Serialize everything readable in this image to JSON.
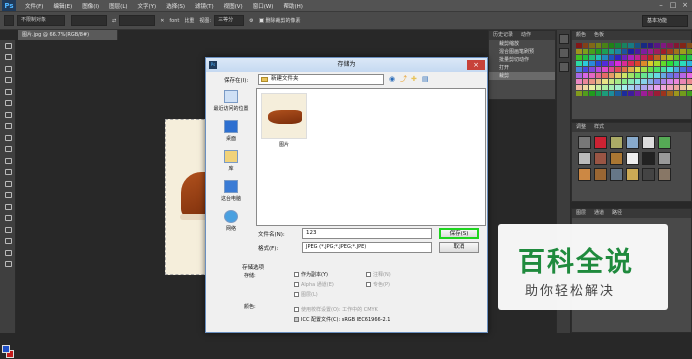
{
  "menubar": {
    "app_logo": "Ps",
    "items": [
      "文件(F)",
      "编辑(E)",
      "图像(I)",
      "图层(L)",
      "文字(Y)",
      "选择(S)",
      "滤镜(T)",
      "视图(V)",
      "窗口(W)",
      "帮助(H)"
    ]
  },
  "optbar": {
    "style_value": "不限制对象",
    "font_label": "font",
    "antialias_label": "比重",
    "view_label": "视图:",
    "view_value": "三等分",
    "delete_cropped": "删除裁剪的像素",
    "workspace": "基本功能"
  },
  "doc_tab": "图片.jpg @ 66.7%(RGB/8#)",
  "history_panel": {
    "tabs": [
      "历史记录",
      "动作"
    ],
    "items": [
      "裁剪缩放",
      "混合图画笔刷预",
      "批量剪切动作",
      "打开",
      "裁剪"
    ]
  },
  "swatches_panel": {
    "tabs": [
      "颜色",
      "色板"
    ]
  },
  "styles_panel": {
    "tabs": [
      "调整",
      "样式"
    ]
  },
  "layers_panel": {
    "tabs": [
      "图层",
      "通道",
      "路径"
    ]
  },
  "dialog": {
    "title": "存储为",
    "app_icon": "Ps",
    "close": "×",
    "save_in_label": "保存在(I):",
    "save_in_value": "新建文件夹",
    "places": [
      "最近访问的位置",
      "桌面",
      "库",
      "这台电脑",
      "网络"
    ],
    "file_item": "图片",
    "filename_label": "文件名(N):",
    "filename_value": "123",
    "format_label": "格式(F):",
    "format_value": "JPEG (*.JPG;*.JPEG;*.JPE)",
    "save_button": "保存(S)",
    "cancel_button": "取消",
    "save_options_title": "存储选项",
    "save_label": "存储:",
    "as_copy": "作为副本(Y)",
    "notes": "注释(N)",
    "alpha": "Alpha 通道(E)",
    "spot": "专色(P)",
    "layers": "图层(L)",
    "color_label": "颜色:",
    "proof_setup": "使用校样设置(O): 工作中的 CMYK",
    "icc_profile": "ICC 配置文件(C): sRGB IEC61966-2.1"
  },
  "watermark": {
    "big": "百科全说",
    "small": "助你轻松解决"
  },
  "colors": {
    "foreground": "#1e4fc7",
    "background": "#c41b1b",
    "highlight": "#1fd41f"
  }
}
